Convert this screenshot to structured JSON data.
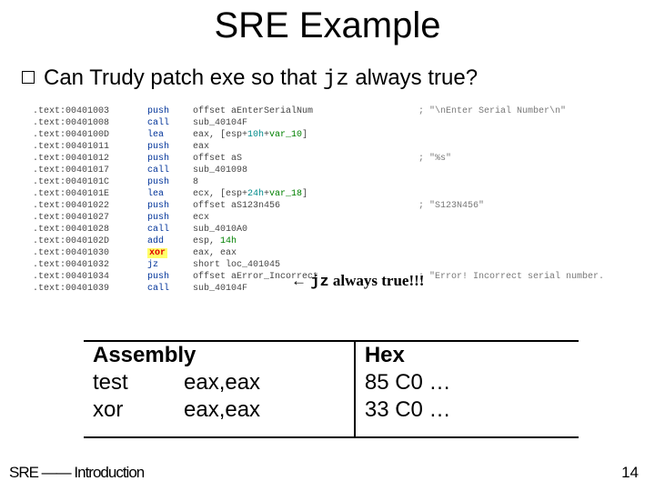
{
  "title": "SRE Example",
  "question_pre": "Can Trudy patch exe so that ",
  "question_code": "jz",
  "question_post": " always true?",
  "annot_arrow": "← ",
  "annot_code": "jz",
  "annot_post": " always true!!!",
  "disasm": [
    {
      "addr": ".text:00401003",
      "m": "push",
      "o": "offset aEnterSerialNum",
      "c": "; \"\\nEnter Serial Number\\n\"",
      "hl": ""
    },
    {
      "addr": ".text:00401008",
      "m": "call",
      "o": "sub_40104F",
      "c": "",
      "hl": ""
    },
    {
      "addr": ".text:0040100D",
      "m": "lea",
      "o": "eax, [esp+10h+var_10]",
      "c": "",
      "hl": "t"
    },
    {
      "addr": ".text:00401011",
      "m": "push",
      "o": "eax",
      "c": "",
      "hl": ""
    },
    {
      "addr": ".text:00401012",
      "m": "push",
      "o": "offset aS",
      "c": "; \"%s\"",
      "hl": ""
    },
    {
      "addr": ".text:00401017",
      "m": "call",
      "o": "sub_401098",
      "c": "",
      "hl": ""
    },
    {
      "addr": ".text:0040101C",
      "m": "push",
      "o": "8",
      "c": "",
      "hl": ""
    },
    {
      "addr": ".text:0040101E",
      "m": "lea",
      "o": "ecx, [esp+24h+var_18]",
      "c": "",
      "hl": "t"
    },
    {
      "addr": ".text:00401022",
      "m": "push",
      "o": "offset aS123n456",
      "c": "; \"S123N456\"",
      "hl": "g"
    },
    {
      "addr": ".text:00401027",
      "m": "push",
      "o": "ecx",
      "c": "",
      "hl": ""
    },
    {
      "addr": ".text:00401028",
      "m": "call",
      "o": "sub_4010A0",
      "c": "",
      "hl": ""
    },
    {
      "addr": ".text:0040102D",
      "m": "add",
      "o": "esp, 14h",
      "c": "",
      "hl": "g2"
    },
    {
      "addr": ".text:00401030",
      "m": "xor",
      "o": "eax, eax",
      "c": "",
      "hl": "x"
    },
    {
      "addr": ".text:00401032",
      "m": "jz",
      "o": "short loc_401045",
      "c": "",
      "hl": ""
    },
    {
      "addr": ".text:00401034",
      "m": "push",
      "o": "offset aError_Incorrect",
      "c": "; \"Error! Incorrect serial number.",
      "hl": ""
    },
    {
      "addr": ".text:00401039",
      "m": "call",
      "o": "sub_40104F",
      "c": "",
      "hl": ""
    }
  ],
  "table": {
    "hdr_asm": "Assembly",
    "hdr_hex": "Hex",
    "rows": [
      {
        "mn": "test",
        "ops": "eax,eax",
        "hex": "85 C0 …"
      },
      {
        "mn": "xor",
        "ops": "eax,eax",
        "hex": "33 C0 …"
      }
    ]
  },
  "footer_left": "SRE —— Introduction",
  "footer_right": "14"
}
